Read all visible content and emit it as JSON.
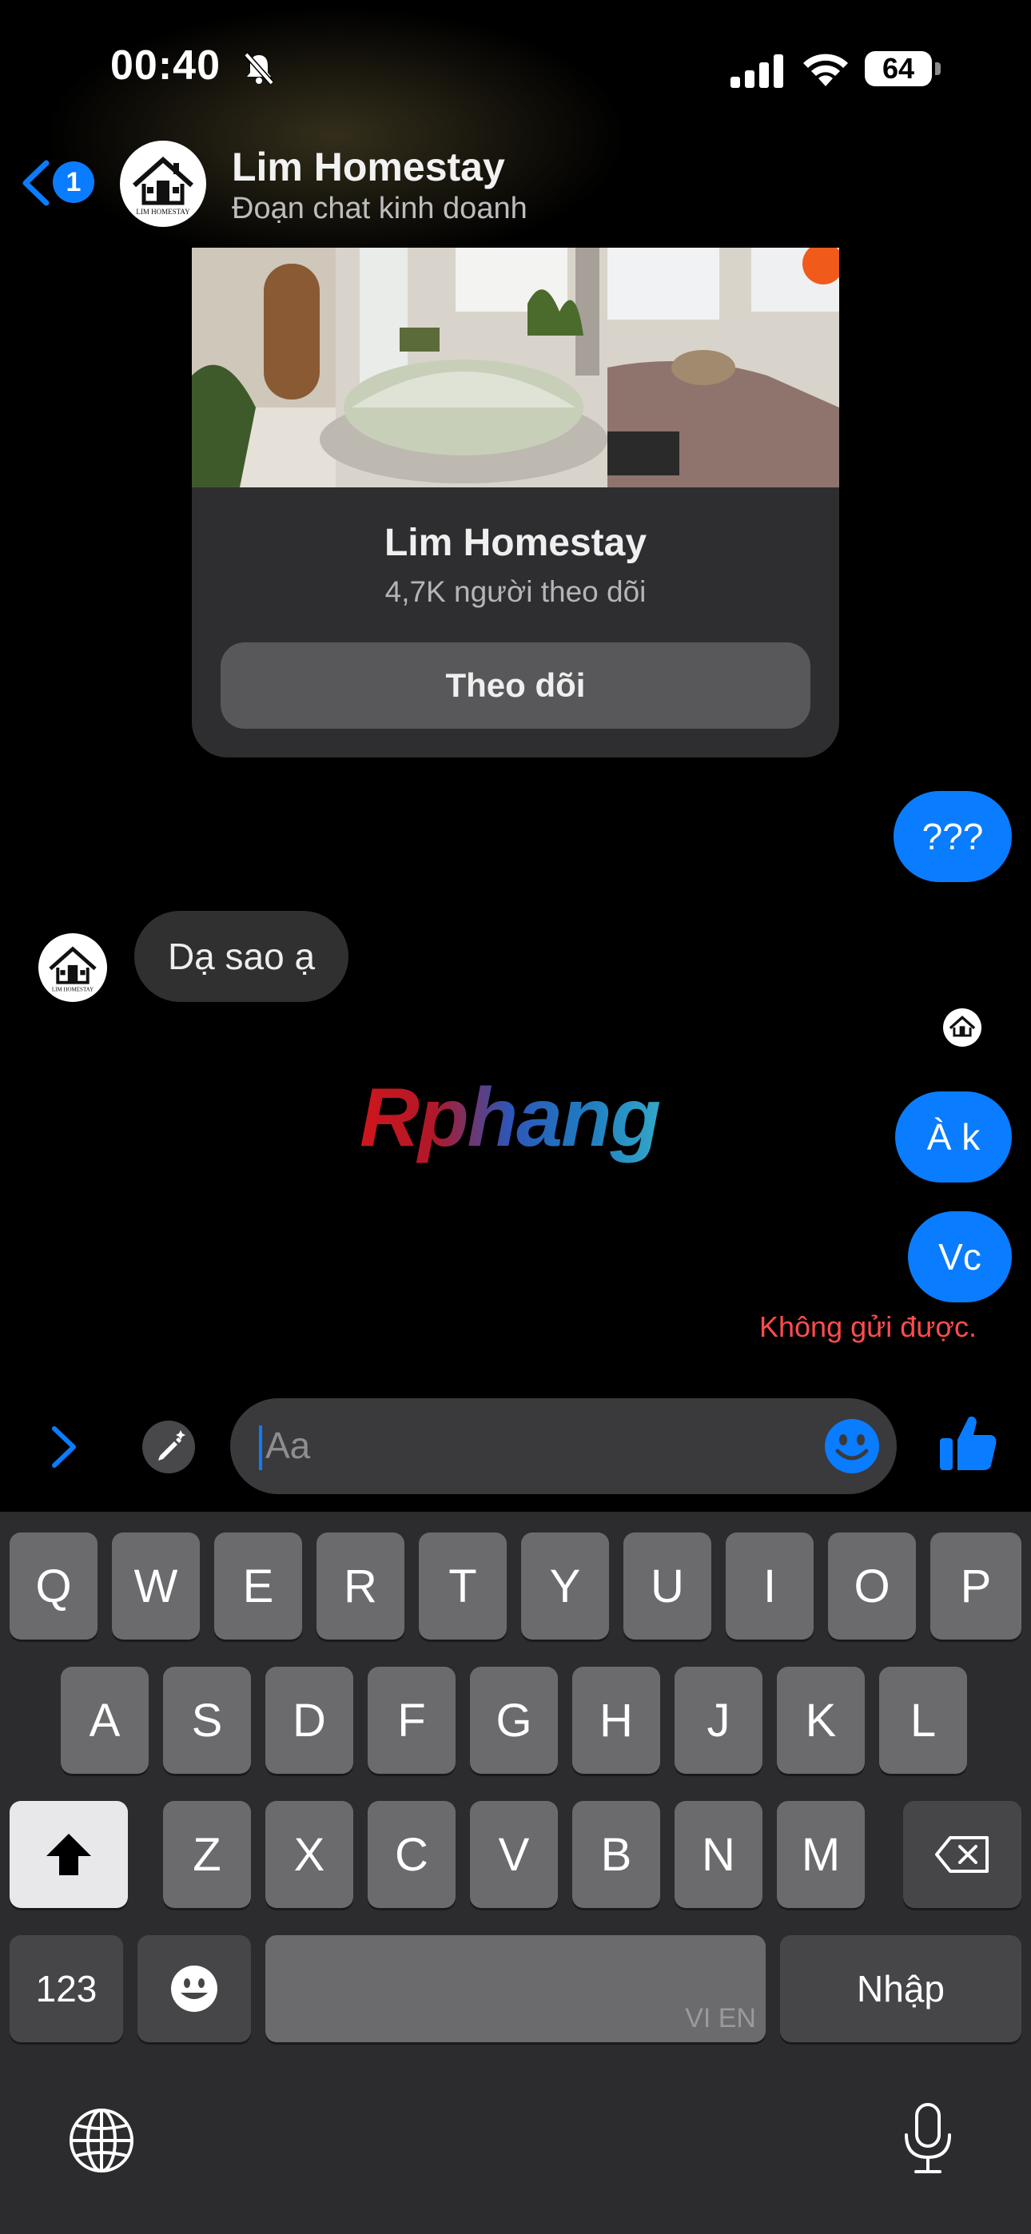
{
  "status_bar": {
    "time": "00:40",
    "battery": "64"
  },
  "header": {
    "back_badge": "1",
    "title": "Lim Homestay",
    "subtitle": "Đoạn chat kinh doanh",
    "avatar_logo_text": "LIM HOMESTAY"
  },
  "page_card": {
    "title": "Lim Homestay",
    "followers": "4,7K người theo dõi",
    "follow_button": "Theo dõi"
  },
  "messages": [
    {
      "direction": "outgoing",
      "text": "???"
    },
    {
      "direction": "incoming",
      "text": "Dạ sao ạ"
    },
    {
      "direction": "outgoing",
      "text": "À k"
    },
    {
      "direction": "outgoing",
      "text": "Vc"
    }
  ],
  "send_error": "Không gửi được.",
  "watermark": "Rphang",
  "composer": {
    "placeholder": "Aa"
  },
  "keyboard": {
    "row1": [
      "Q",
      "W",
      "E",
      "R",
      "T",
      "Y",
      "U",
      "I",
      "O",
      "P"
    ],
    "row2": [
      "A",
      "S",
      "D",
      "F",
      "G",
      "H",
      "J",
      "K",
      "L"
    ],
    "row3": [
      "Z",
      "X",
      "C",
      "V",
      "B",
      "N",
      "M"
    ],
    "numbers_key": "123",
    "space_sublabel": "VI EN",
    "return_key": "Nhập"
  },
  "colors": {
    "accent": "#0a7cff",
    "error": "#ff4d4d",
    "bubble_incoming": "#303030",
    "keyboard_bg": "#2c2c2e"
  },
  "icons": [
    "muted-bell-icon",
    "signal-icon",
    "wifi-icon",
    "battery-icon",
    "back-chevron-icon",
    "expand-chevron-icon",
    "edit-image-icon",
    "emoji-icon",
    "like-thumb-icon",
    "shift-icon",
    "delete-icon",
    "emoji-keyboard-icon",
    "globe-icon",
    "microphone-icon"
  ]
}
